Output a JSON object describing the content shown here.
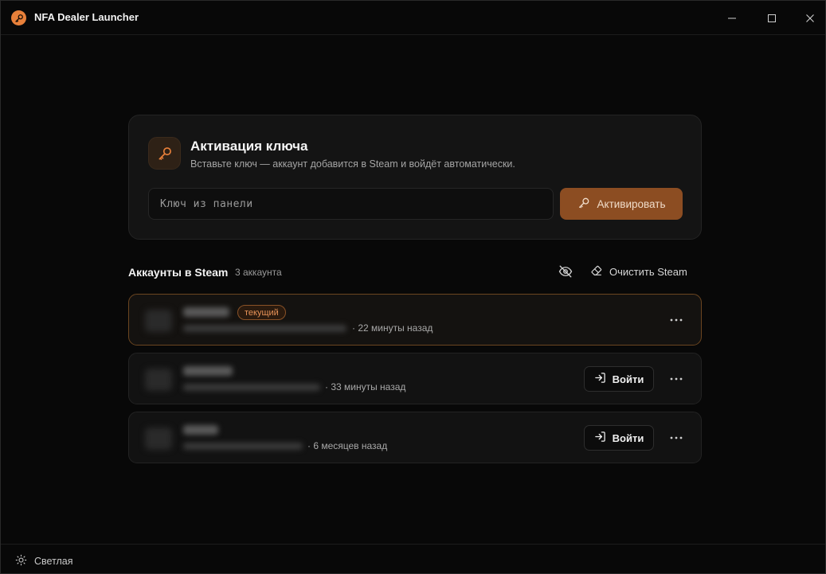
{
  "window": {
    "title": "NFA Dealer Launcher"
  },
  "activation": {
    "title": "Активация ключа",
    "subtitle": "Вставьте ключ — аккаунт добавится в Steam и войдёт автоматически.",
    "input_placeholder": "Ключ из панели",
    "input_value": "",
    "button_label": "Активировать"
  },
  "accounts": {
    "title": "Аккаунты в Steam",
    "count": "3 аккаунта",
    "clear_label": "Очистить Steam",
    "items": [
      {
        "current_badge": "текущий",
        "last_seen": "· 22 минуты назад",
        "login_label": ""
      },
      {
        "current_badge": "",
        "last_seen": "· 33 минуты назад",
        "login_label": "Войти"
      },
      {
        "current_badge": "",
        "last_seen": "· 6 месяцев назад",
        "login_label": "Войти"
      }
    ]
  },
  "footer": {
    "theme_label": "Светлая"
  },
  "colors": {
    "accent": "#e8803a",
    "accent_button": "#8c4d22",
    "background": "#080808",
    "card": "#141414"
  },
  "icons": {
    "app": "key-icon",
    "minimize": "minimize-icon",
    "maximize": "maximize-icon",
    "close": "close-icon",
    "hide": "eye-off-icon",
    "clear": "eraser-icon",
    "login": "login-arrow-icon",
    "more": "more-horizontal-icon",
    "theme": "sun-icon"
  }
}
